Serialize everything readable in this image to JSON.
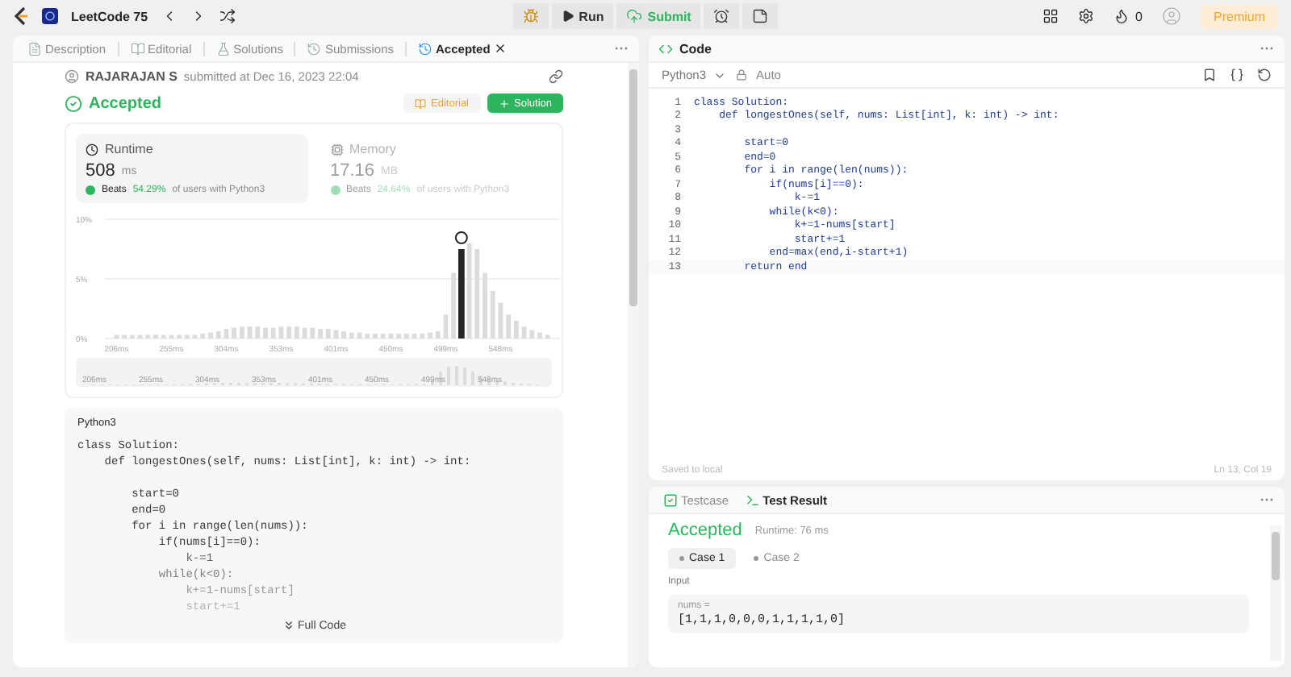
{
  "top_bar": {
    "list_name": "LeetCode 75",
    "run": "Run",
    "submit": "Submit",
    "streak": "0",
    "premium": "Premium"
  },
  "left_tabs": [
    {
      "label": "Description",
      "selected": false,
      "closable": false
    },
    {
      "label": "Editorial",
      "selected": false,
      "closable": false
    },
    {
      "label": "Solutions",
      "selected": false,
      "closable": false
    },
    {
      "label": "Submissions",
      "selected": false,
      "closable": false
    },
    {
      "label": "Accepted",
      "selected": true,
      "closable": true
    }
  ],
  "submission": {
    "author": "RAJARAJAN S",
    "submitted": "submitted at Dec 16, 2023 22:04",
    "status": "Accepted",
    "editorial_button": "Editorial",
    "solution_button": "Solution"
  },
  "stats": [
    {
      "label": "Runtime",
      "value": "508",
      "unit": "ms",
      "beats": "Beats",
      "percent": "54.29%",
      "suffix": "of users with Python3",
      "selected": true
    },
    {
      "label": "Memory",
      "value": "17.16",
      "unit": "MB",
      "beats": "Beats",
      "percent": "24.64%",
      "suffix": "of users with Python3",
      "selected": false
    }
  ],
  "chart_data": {
    "type": "bar",
    "categories": [
      "206ms",
      null,
      null,
      null,
      null,
      null,
      null,
      "255ms",
      null,
      null,
      null,
      null,
      null,
      null,
      "304ms",
      null,
      null,
      null,
      null,
      null,
      null,
      "353ms",
      null,
      null,
      null,
      null,
      null,
      null,
      "401ms",
      null,
      null,
      null,
      null,
      null,
      null,
      "450ms",
      null,
      null,
      null,
      null,
      null,
      null,
      "499ms",
      null,
      null,
      null,
      null,
      null,
      null,
      "548ms",
      null,
      null,
      null,
      null,
      null,
      null
    ],
    "series": [
      {
        "color": "#dcdcdc",
        "values": [
          0.3,
          0.3,
          0.3,
          0.3,
          0.3,
          0.3,
          0.3,
          0.3,
          0.3,
          0.3,
          0.3,
          0.4,
          0.5,
          0.6,
          0.8,
          0.9,
          1.0,
          1.0,
          1.0,
          0.9,
          0.9,
          1.0,
          1.0,
          1.0,
          0.9,
          0.9,
          0.8,
          0.8,
          0.7,
          0.6,
          0.5,
          0.5,
          0.4,
          0.4,
          0.4,
          0.4,
          0.4,
          0.4,
          0.4,
          0.4,
          0.5,
          0.6,
          2.0,
          5.5,
          null,
          8.0,
          7.5,
          5.5,
          4.0,
          3.0,
          2.0,
          1.5,
          1.0,
          0.7,
          0.5,
          0.3
        ]
      },
      {
        "color": "#262626",
        "values": [
          null,
          null,
          null,
          null,
          null,
          null,
          null,
          null,
          null,
          null,
          null,
          null,
          null,
          null,
          null,
          null,
          null,
          null,
          null,
          null,
          null,
          null,
          null,
          null,
          null,
          null,
          null,
          null,
          null,
          null,
          null,
          null,
          null,
          null,
          null,
          null,
          null,
          null,
          null,
          null,
          null,
          null,
          null,
          null,
          7.5,
          null,
          null,
          null,
          null,
          null,
          null,
          null,
          null,
          null,
          null,
          null
        ]
      }
    ],
    "ylim": [
      0,
      10
    ],
    "yticks": [
      {
        "value": 0,
        "label": "0%"
      },
      {
        "value": 5,
        "label": "5%"
      },
      {
        "value": 10,
        "label": "10%"
      }
    ]
  },
  "overview_labels": [
    "206ms",
    "255ms",
    "304ms",
    "353ms",
    "401ms",
    "450ms",
    "499ms",
    "548ms"
  ],
  "code_preview": {
    "language": "Python3",
    "lines": [
      {
        "text": "class Solution:"
      },
      {
        "text": "    def longestOnes(self, nums: List[int], k: int) -> int:"
      },
      {
        "text": "        start=0",
        "gap_before": true
      },
      {
        "text": "        end=0"
      },
      {
        "text": "        for i in range(len(nums)):"
      },
      {
        "text": "            if(nums[i]==0):"
      },
      {
        "text": "                k-=1"
      },
      {
        "text": "            while(k<0):"
      },
      {
        "text": "                k+=1-nums[start]"
      },
      {
        "text": "                start+=1"
      }
    ],
    "full_code": "Full Code"
  },
  "editor": {
    "title": "Code",
    "language": "Python3",
    "mode": "Auto",
    "lines": [
      {
        "no": "1",
        "text": "class Solution:"
      },
      {
        "no": "2",
        "text": "    def longestOnes(self, nums: List[int], k: int) -> int:"
      },
      {
        "no": "3"
      },
      {
        "no": "4",
        "text": "        start=0"
      },
      {
        "no": "5",
        "text": "        end=0"
      },
      {
        "no": "6",
        "text": "        for i in range(len(nums)):"
      },
      {
        "no": "7",
        "text": "            if(nums[i]==0):"
      },
      {
        "no": "8",
        "text": "                k-=1"
      },
      {
        "no": "9",
        "text": "            while(k<0):"
      },
      {
        "no": "10",
        "text": "                k+=1-nums[start]"
      },
      {
        "no": "11",
        "text": "                start+=1"
      },
      {
        "no": "12",
        "text": "            end=max(end,i-start+1)"
      },
      {
        "no": "13",
        "text": "        return end"
      }
    ],
    "saved": "Saved to local",
    "cursor": "Ln 13, Col 19"
  },
  "bottom_tabs": [
    {
      "label": "Testcase",
      "selected": false
    },
    {
      "label": "Test Result",
      "selected": true
    }
  ],
  "result": {
    "status": "Accepted",
    "runtime": "Runtime: 76 ms",
    "cases": [
      {
        "label": "Case 1",
        "selected": true
      },
      {
        "label": "Case 2",
        "selected": false
      }
    ],
    "input_label": "Input",
    "var": "nums =",
    "value": "[1,1,1,0,0,0,1,1,1,1,0]"
  }
}
